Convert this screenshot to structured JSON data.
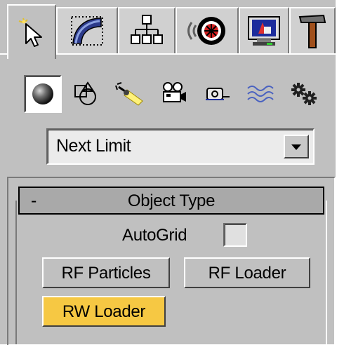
{
  "tabs": [
    {
      "name": "create",
      "icon": "create-cursor-icon",
      "active": true
    },
    {
      "name": "modify",
      "icon": "modify-arc-icon",
      "active": false
    },
    {
      "name": "hierarchy",
      "icon": "hierarchy-tree-icon",
      "active": false
    },
    {
      "name": "motion",
      "icon": "motion-wheel-icon",
      "active": false
    },
    {
      "name": "display",
      "icon": "display-monitor-icon",
      "active": false
    },
    {
      "name": "utilities",
      "icon": "utilities-hammer-icon",
      "active": false
    }
  ],
  "categories": [
    {
      "name": "geometry",
      "icon": "geometry-sphere-icon",
      "selected": true
    },
    {
      "name": "shapes",
      "icon": "shapes-icon",
      "selected": false
    },
    {
      "name": "lights",
      "icon": "lights-icon",
      "selected": false
    },
    {
      "name": "cameras",
      "icon": "camera-icon",
      "selected": false
    },
    {
      "name": "helpers",
      "icon": "helpers-tape-icon",
      "selected": false
    },
    {
      "name": "space-warps",
      "icon": "space-warps-icon",
      "selected": false
    },
    {
      "name": "systems",
      "icon": "systems-gears-icon",
      "selected": false
    }
  ],
  "dropdown": {
    "value": "Next Limit"
  },
  "rollout": {
    "collapse_symbol": "-",
    "title": "Object Type"
  },
  "autogrid": {
    "label": "AutoGrid",
    "checked": false
  },
  "buttons": {
    "rf_particles": "RF Particles",
    "rf_loader": "RF Loader",
    "rw_loader": "RW Loader"
  },
  "colors": {
    "panel_bg": "#c0c0c0",
    "highlight_button": "#f6c843",
    "rollout_header": "#a9a9a9"
  }
}
